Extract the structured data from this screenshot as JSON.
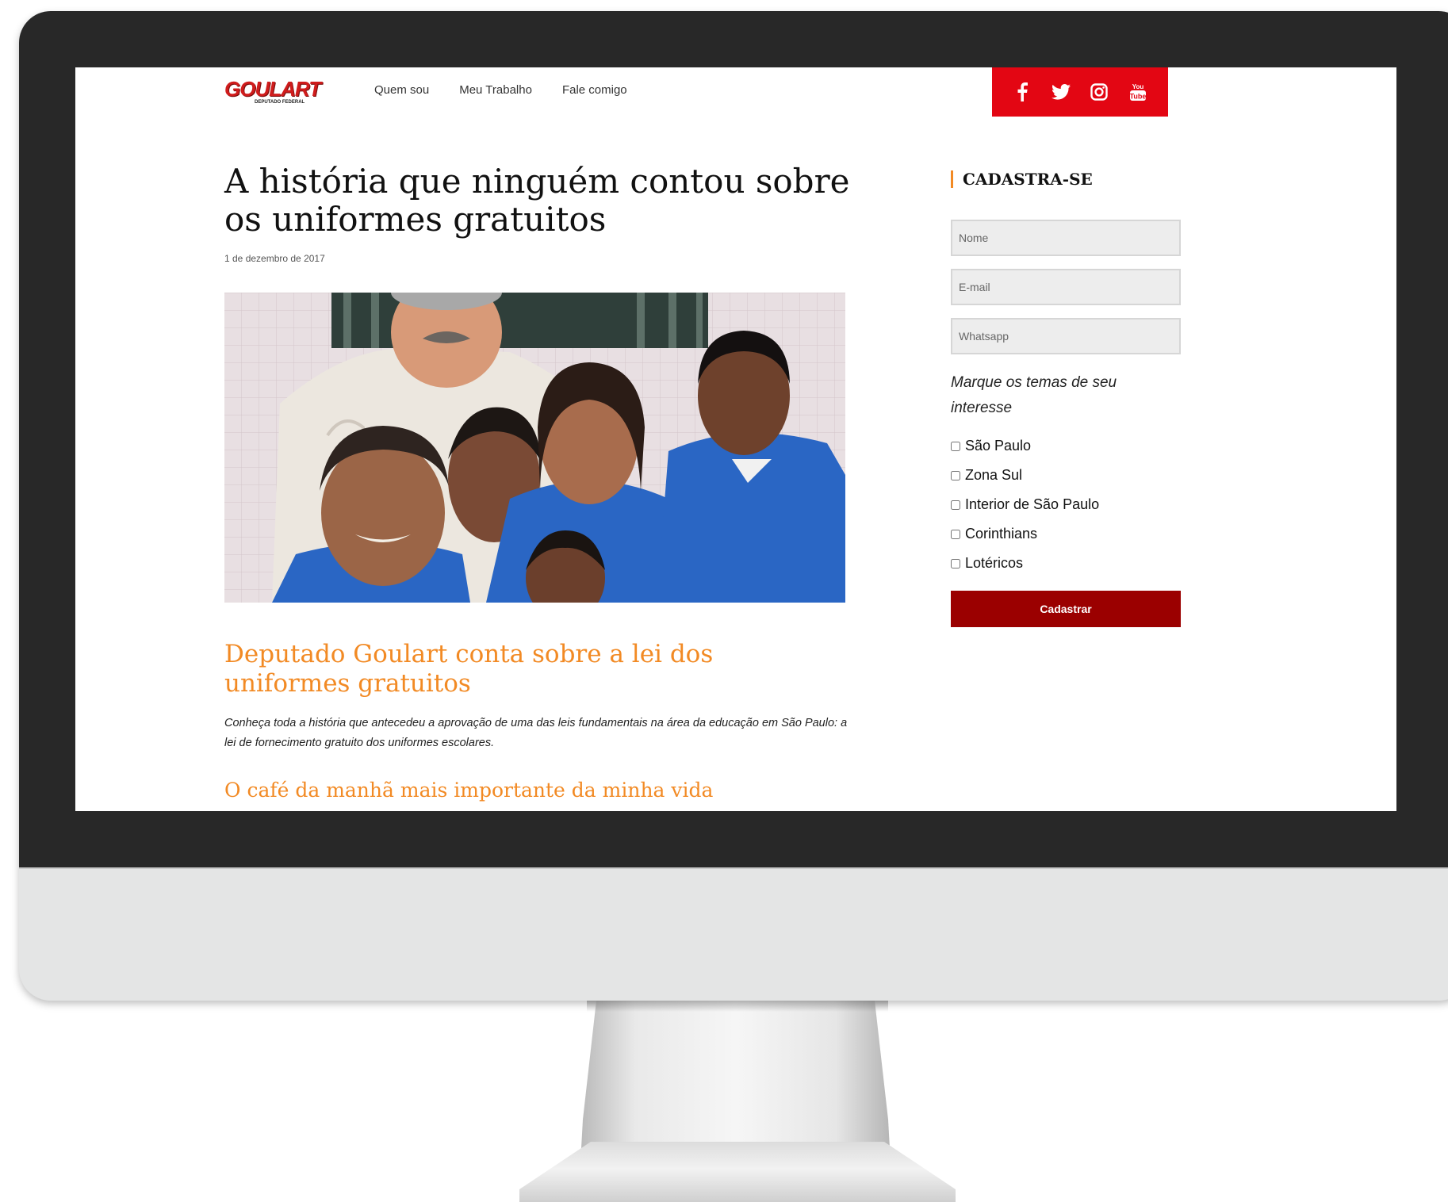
{
  "header": {
    "logo_text": "GOULART",
    "logo_subtext": "DEPUTADO FEDERAL",
    "nav": [
      "Quem sou",
      "Meu Trabalho",
      "Fale comigo"
    ],
    "social_icons": [
      "facebook-icon",
      "twitter-icon",
      "instagram-icon",
      "youtube-icon"
    ],
    "social_bar_color": "#e30613"
  },
  "article": {
    "title": "A história que ninguém contou sobre os uniformes gratuitos",
    "date": "1 de dezembro de 2017",
    "photo": "group-photo-students-blue-uniforms",
    "subtitle": "Deputado Goulart conta sobre a lei dos uniformes gratuitos",
    "lead": "Conheça toda a história que antecedeu a aprovação de uma das leis fundamentais na área da educação em São Paulo: a lei de fornecimento gratuito dos uniformes escolares.",
    "section_title": "O café da manhã mais importante da minha vida",
    "accent_color": "#f28a24"
  },
  "sidebar": {
    "title": "CADASTRA-SE",
    "fields": [
      {
        "placeholder": "Nome"
      },
      {
        "placeholder": "E-mail"
      },
      {
        "placeholder": "Whatsapp"
      }
    ],
    "interest_label": "Marque os temas de seu interesse",
    "topics": [
      "São Paulo",
      "Zona Sul",
      "Interior de São Paulo",
      "Corinthians",
      "Lotéricos"
    ],
    "submit_label": "Cadastrar",
    "submit_color": "#9b0000"
  }
}
